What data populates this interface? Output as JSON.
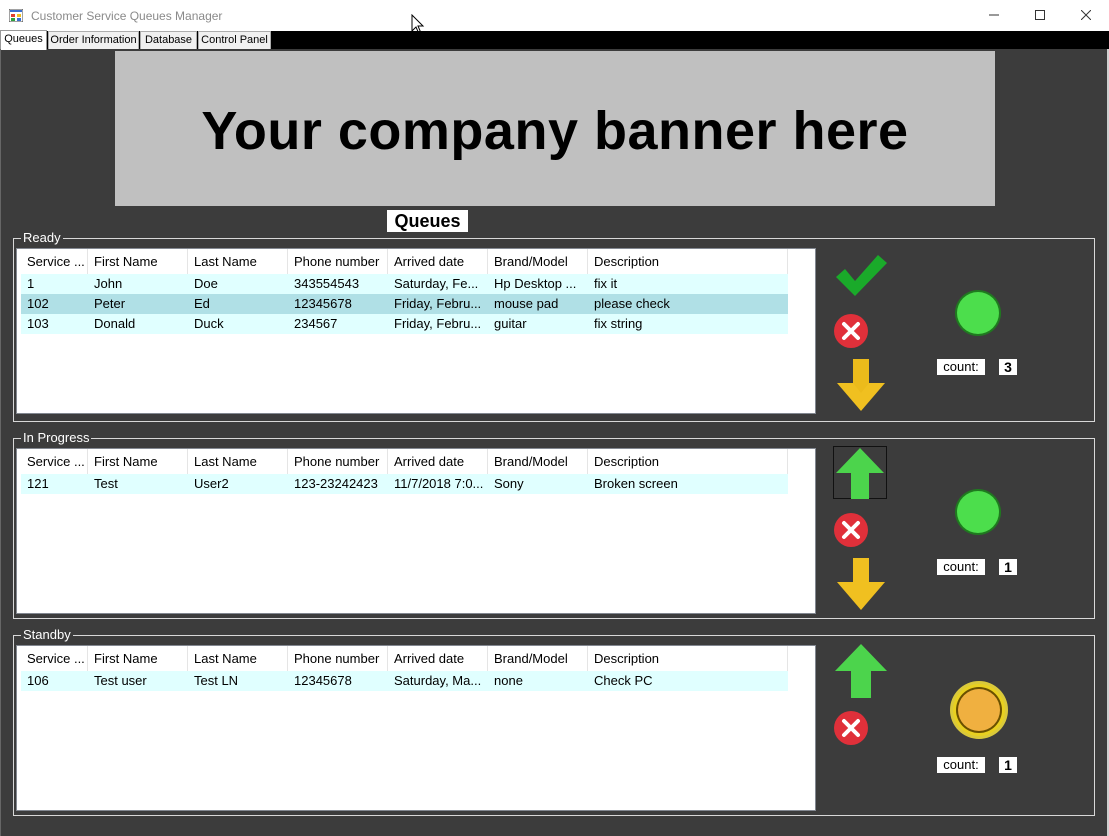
{
  "window": {
    "title": "Customer Service Queues Manager",
    "controls": [
      "minimize",
      "maximize",
      "close"
    ]
  },
  "tabs": [
    {
      "label": "Queues",
      "active": true
    },
    {
      "label": "Order Information",
      "active": false
    },
    {
      "label": "Database",
      "active": false
    },
    {
      "label": "Control Panel",
      "active": false
    }
  ],
  "banner": {
    "text": "Your company banner here"
  },
  "queues_title": "Queues",
  "columns": [
    "Service ...",
    "First Name",
    "Last Name",
    "Phone number",
    "Arrived date",
    "Brand/Model",
    "Description"
  ],
  "groups": {
    "ready": {
      "label": "Ready",
      "rows": [
        {
          "cells": [
            "1",
            "John",
            "Doe",
            "343554543",
            "Saturday, Fe...",
            "Hp Desktop ...",
            "fix it"
          ],
          "selected": false
        },
        {
          "cells": [
            "102",
            "Peter",
            "Ed",
            "12345678",
            "Friday, Febru...",
            "mouse pad",
            "please check"
          ],
          "selected": true
        },
        {
          "cells": [
            "103",
            "Donald",
            "Duck",
            "234567",
            "Friday, Febru...",
            "guitar",
            "fix string"
          ],
          "selected": false
        }
      ],
      "actions": [
        "check-icon",
        "cancel-icon",
        "arrow-down-icon"
      ],
      "status_color": "#4cde4c",
      "count_label": "count:",
      "count": "3"
    },
    "in_progress": {
      "label": "In Progress",
      "rows": [
        {
          "cells": [
            "121",
            "Test",
            "User2",
            "123-23242423",
            "11/7/2018 7:0...",
            "Sony",
            "Broken screen"
          ],
          "selected": false
        }
      ],
      "actions": [
        "arrow-up-icon",
        "cancel-icon",
        "arrow-down-icon"
      ],
      "status_color": "#4cde4c",
      "count_label": "count:",
      "count": "1"
    },
    "standby": {
      "label": "Standby",
      "rows": [
        {
          "cells": [
            "106",
            "Test user",
            "Test LN",
            "12345678",
            "Saturday, Ma...",
            "none",
            "Check PC"
          ],
          "selected": false
        }
      ],
      "actions": [
        "arrow-up-icon",
        "cancel-icon"
      ],
      "status_color": "#f0b040",
      "count_label": "count:",
      "count": "1"
    }
  },
  "colors": {
    "background": "#3c3c3c",
    "banner": "#c0c0c0",
    "row": "#e0ffff",
    "row_selected": "#b0e0e6",
    "check": "#1aaa2a",
    "cancel": "#e0303a",
    "arrow_down": "#f0c020",
    "arrow_up": "#4cd44c"
  }
}
